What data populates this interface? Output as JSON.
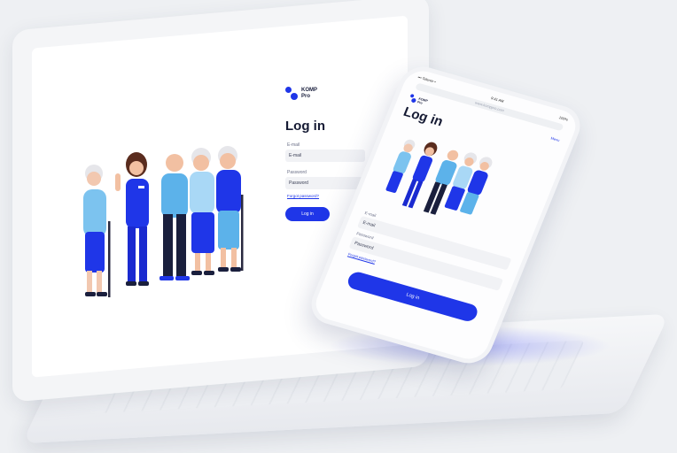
{
  "brand": {
    "name_line1": "KOMP",
    "name_line2": "Pro",
    "accent": "#1f36e8"
  },
  "laptop": {
    "heading": "Log in",
    "email_label": "E-mail",
    "email_value": "E-mail",
    "password_label": "Password",
    "password_value": "Password",
    "forgot": "Forgot password?",
    "button": "Log in"
  },
  "phone": {
    "status_left": "••• Telenor •",
    "status_time": "9:41 AM",
    "status_right": "100%",
    "url": "www.komppro.com",
    "menu": "Menu",
    "heading": "Log in",
    "email_label": "E-mail",
    "email_value": "E-mail",
    "password_label": "Password",
    "password_value": "Password",
    "forgot": "Forgot password?",
    "button": "Log in"
  },
  "icons": {
    "logo": "komp-logo-icon",
    "illustration": "elderly-group-with-nurse-illustration"
  }
}
